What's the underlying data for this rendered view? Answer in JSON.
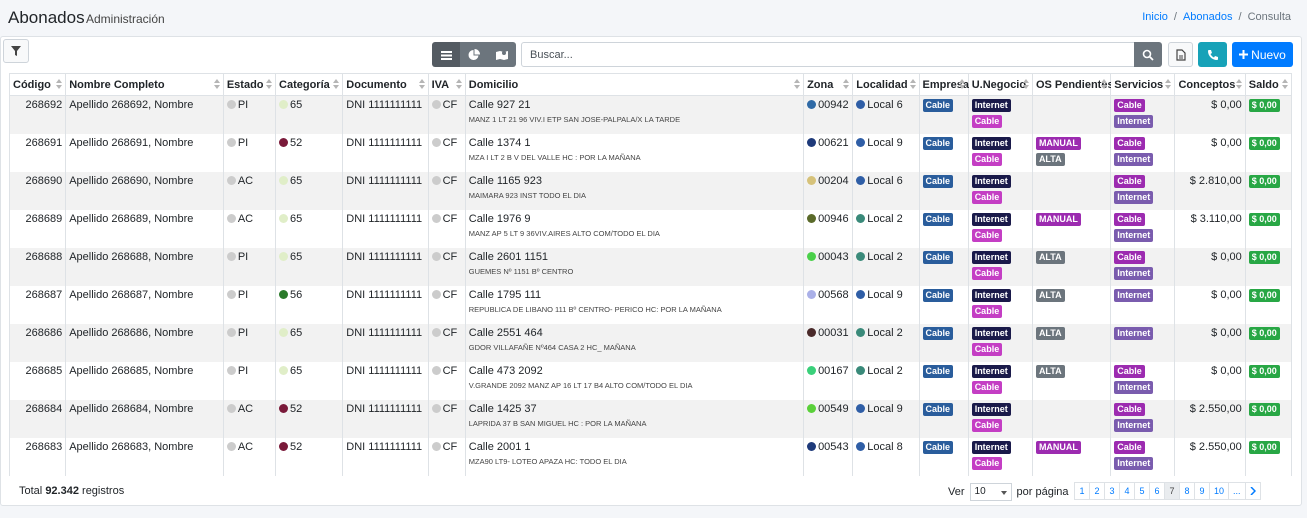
{
  "header": {
    "title": "Abonados",
    "subtitle": "Administración",
    "breadcrumb": [
      "Inicio",
      "Abonados",
      "Consulta"
    ]
  },
  "toolbar": {
    "search_placeholder": "Buscar...",
    "new_label": "Nuevo"
  },
  "colors": {
    "empresa": "#2a5d9c",
    "internet": "#1a1a4a",
    "cable": "#c43ec4",
    "saldo": "#28a745",
    "accent": "#007bff",
    "info": "#17a2b8"
  },
  "columns": [
    "Código",
    "Nombre Completo",
    "Estado",
    "Categoría",
    "Documento",
    "IVA",
    "Domicilio",
    "Zona",
    "Localidad",
    "Empresa",
    "U.Negocio",
    "OS Pendientes",
    "Servicios",
    "Conceptos",
    "Saldo"
  ],
  "rows": [
    {
      "codigo": "268692",
      "nombre": "Apellido 268692, Nombre",
      "estado": "PI",
      "categoria": "65",
      "cat_color": "#e0eec8",
      "documento": "DNI 1111111111",
      "iva": "CF",
      "calle": "Calle 927 21",
      "detalle": "MANZ 1 LT 21 96 VIV.I ETP SAN JOSE-PALPALA/X LA TARDE",
      "zona": "00942",
      "zona_color": "#2f6aa6",
      "localidad": "Local 6",
      "loc_color": "#2f5ea6",
      "empresa": "Cable",
      "unegocio": [
        "Internet",
        "Cable"
      ],
      "os": [],
      "servicios": [
        "Cable",
        "Internet"
      ],
      "conceptos": "$ 0,00",
      "saldo": "$ 0,00"
    },
    {
      "codigo": "268691",
      "nombre": "Apellido 268691, Nombre",
      "estado": "PI",
      "categoria": "52",
      "cat_color": "#7a1a3a",
      "documento": "DNI 1111111111",
      "iva": "CF",
      "calle": "Calle 1374 1",
      "detalle": "MZA I LT 2 B V DEL VALLE HC : POR LA MAÑANA",
      "zona": "00621",
      "zona_color": "#1e3a7a",
      "localidad": "Local 9",
      "loc_color": "#2f5ea6",
      "empresa": "Cable",
      "unegocio": [
        "Internet",
        "Cable"
      ],
      "os": [
        "MANUAL",
        "ALTA"
      ],
      "servicios": [
        "Cable",
        "Internet"
      ],
      "conceptos": "$ 0,00",
      "saldo": "$ 0,00"
    },
    {
      "codigo": "268690",
      "nombre": "Apellido 268690, Nombre",
      "estado": "AC",
      "categoria": "65",
      "cat_color": "#e0eec8",
      "documento": "DNI 1111111111",
      "iva": "CF",
      "calle": "Calle 1165 923",
      "detalle": "MAIMARA 923 INST TODO EL DIA",
      "zona": "00204",
      "zona_color": "#d6c27a",
      "localidad": "Local 6",
      "loc_color": "#2f5ea6",
      "empresa": "Cable",
      "unegocio": [
        "Internet",
        "Cable"
      ],
      "os": [],
      "servicios": [
        "Cable",
        "Internet"
      ],
      "conceptos": "$ 2.810,00",
      "saldo": "$ 0,00"
    },
    {
      "codigo": "268689",
      "nombre": "Apellido 268689, Nombre",
      "estado": "AC",
      "categoria": "65",
      "cat_color": "#e0eec8",
      "documento": "DNI 1111111111",
      "iva": "CF",
      "calle": "Calle 1976 9",
      "detalle": "MANZ AP 5 LT 9 36VIV.AIRES ALTO COM/TODO EL DIA",
      "zona": "00946",
      "zona_color": "#5a6a2a",
      "localidad": "Local 2",
      "loc_color": "#3a8a7a",
      "empresa": "Cable",
      "unegocio": [
        "Internet",
        "Cable"
      ],
      "os": [
        "MANUAL"
      ],
      "servicios": [
        "Cable",
        "Internet"
      ],
      "conceptos": "$ 3.110,00",
      "saldo": "$ 0,00"
    },
    {
      "codigo": "268688",
      "nombre": "Apellido 268688, Nombre",
      "estado": "PI",
      "categoria": "65",
      "cat_color": "#e0eec8",
      "documento": "DNI 1111111111",
      "iva": "CF",
      "calle": "Calle 2601 1151",
      "detalle": "GUEMES Nº 1151 Bº CENTRO",
      "zona": "00043",
      "zona_color": "#4ad04a",
      "localidad": "Local 2",
      "loc_color": "#3a8a7a",
      "empresa": "Cable",
      "unegocio": [
        "Internet",
        "Cable"
      ],
      "os": [
        "ALTA"
      ],
      "servicios": [
        "Cable",
        "Internet"
      ],
      "conceptos": "$ 0,00",
      "saldo": "$ 0,00"
    },
    {
      "codigo": "268687",
      "nombre": "Apellido 268687, Nombre",
      "estado": "PI",
      "categoria": "56",
      "cat_color": "#2a7a2a",
      "documento": "DNI 1111111111",
      "iva": "CF",
      "calle": "Calle 1795 111",
      "detalle": "REPUBLICA DE LIBANO 111 Bº CENTRO- PERICO HC: POR LA MAÑANA",
      "zona": "00568",
      "zona_color": "#aab0e8",
      "localidad": "Local 9",
      "loc_color": "#2f5ea6",
      "empresa": "Cable",
      "unegocio": [
        "Internet",
        "Cable"
      ],
      "os": [
        "ALTA"
      ],
      "servicios": [
        "Internet"
      ],
      "conceptos": "$ 0,00",
      "saldo": "$ 0,00"
    },
    {
      "codigo": "268686",
      "nombre": "Apellido 268686, Nombre",
      "estado": "PI",
      "categoria": "65",
      "cat_color": "#e0eec8",
      "documento": "DNI 1111111111",
      "iva": "CF",
      "calle": "Calle 2551 464",
      "detalle": "GDOR VILLAFAÑE Nº464 CASA 2 HC_ MAÑANA",
      "zona": "00031",
      "zona_color": "#4a2a2a",
      "localidad": "Local 2",
      "loc_color": "#3a8a7a",
      "empresa": "Cable",
      "unegocio": [
        "Internet",
        "Cable"
      ],
      "os": [
        "ALTA"
      ],
      "servicios": [
        "Internet"
      ],
      "conceptos": "$ 0,00",
      "saldo": "$ 0,00"
    },
    {
      "codigo": "268685",
      "nombre": "Apellido 268685, Nombre",
      "estado": "PI",
      "categoria": "65",
      "cat_color": "#e0eec8",
      "documento": "DNI 1111111111",
      "iva": "CF",
      "calle": "Calle 473 2092",
      "detalle": "V.GRANDE 2092 MANZ AP 16 LT 17 B4 ALTO COM/TODO EL DIA",
      "zona": "00167",
      "zona_color": "#3ad07a",
      "localidad": "Local 2",
      "loc_color": "#3a8a7a",
      "empresa": "Cable",
      "unegocio": [
        "Internet",
        "Cable"
      ],
      "os": [
        "ALTA"
      ],
      "servicios": [
        "Cable",
        "Internet"
      ],
      "conceptos": "$ 0,00",
      "saldo": "$ 0,00"
    },
    {
      "codigo": "268684",
      "nombre": "Apellido 268684, Nombre",
      "estado": "AC",
      "categoria": "52",
      "cat_color": "#7a1a3a",
      "documento": "DNI 1111111111",
      "iva": "CF",
      "calle": "Calle 1425 37",
      "detalle": "LAPRIDA 37 B SAN MIGUEL HC : POR LA MAÑANA",
      "zona": "00549",
      "zona_color": "#5ad03a",
      "localidad": "Local 9",
      "loc_color": "#2f5ea6",
      "empresa": "Cable",
      "unegocio": [
        "Internet",
        "Cable"
      ],
      "os": [],
      "servicios": [
        "Cable",
        "Internet"
      ],
      "conceptos": "$ 2.550,00",
      "saldo": "$ 0,00"
    },
    {
      "codigo": "268683",
      "nombre": "Apellido 268683, Nombre",
      "estado": "AC",
      "categoria": "52",
      "cat_color": "#7a1a3a",
      "documento": "DNI 1111111111",
      "iva": "CF",
      "calle": "Calle 2001 1",
      "detalle": "MZA90 LT9- LOTEO APAZA HC: TODO EL DIA",
      "zona": "00543",
      "zona_color": "#1e3a7a",
      "localidad": "Local 8",
      "loc_color": "#2f5ea6",
      "empresa": "Cable",
      "unegocio": [
        "Internet",
        "Cable"
      ],
      "os": [
        "MANUAL"
      ],
      "servicios": [
        "Cable",
        "Internet"
      ],
      "conceptos": "$ 2.550,00",
      "saldo": "$ 0,00"
    }
  ],
  "footer": {
    "total_prefix": "Total",
    "total_value": "92.342",
    "total_suffix": "registros",
    "ver_label": "Ver",
    "per_page": "10",
    "per_page_label": "por página",
    "pages": [
      "1",
      "2",
      "3",
      "4",
      "5",
      "6",
      "7",
      "8",
      "9",
      "10",
      "..."
    ],
    "active_page": "7"
  }
}
